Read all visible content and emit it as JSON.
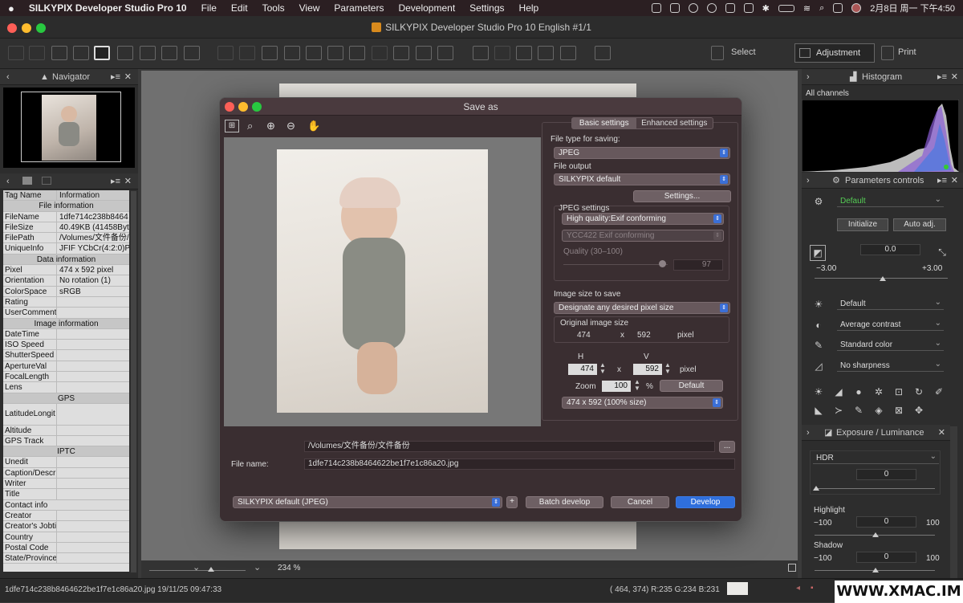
{
  "menubar": {
    "app": "SILKYPIX Developer Studio Pro 10",
    "items": [
      "File",
      "Edit",
      "Tools",
      "View",
      "Parameters",
      "Development",
      "Settings",
      "Help"
    ],
    "clock": "2月8日 周一 下午4:50"
  },
  "window": {
    "title": "SILKYPIX Developer Studio Pro 10 English   #1/1"
  },
  "toolbar": {
    "select": "Select",
    "adjustment": "Adjustment",
    "print": "Print"
  },
  "navigator": {
    "title": "Navigator"
  },
  "taginfo": {
    "col_tag": "Tag Name",
    "col_info": "Information",
    "rows": [
      {
        "type": "sec",
        "k": "File information"
      },
      {
        "k": "FileName",
        "v": "1dfe714c238b8464"
      },
      {
        "k": "FileSize",
        "v": "40.49KB (41458Byte"
      },
      {
        "k": "FilePath",
        "v": "/Volumes/文件备份/"
      },
      {
        "k": "UniqueInfo",
        "v": "JFIF YCbCr(4:2:0)Pro"
      },
      {
        "type": "sec",
        "k": "Data information"
      },
      {
        "k": "Pixel",
        "v": "474 x 592 pixel"
      },
      {
        "k": "Orientation",
        "v": "No rotation (1)"
      },
      {
        "k": "ColorSpace",
        "v": "sRGB"
      },
      {
        "k": "Rating",
        "v": ""
      },
      {
        "k": "UserComment",
        "v": ""
      },
      {
        "type": "sec",
        "k": "Image information"
      },
      {
        "k": "DateTime",
        "v": ""
      },
      {
        "k": "ISO Speed",
        "v": ""
      },
      {
        "k": "ShutterSpeed",
        "v": ""
      },
      {
        "k": "ApertureVal",
        "v": ""
      },
      {
        "k": "FocalLength",
        "v": ""
      },
      {
        "k": "Lens",
        "v": ""
      },
      {
        "type": "sec",
        "k": "GPS"
      },
      {
        "k": "LatitudeLongit",
        "v": "",
        "tall": true
      },
      {
        "k": "Altitude",
        "v": ""
      },
      {
        "k": "GPS Track",
        "v": ""
      },
      {
        "type": "sec",
        "k": "IPTC"
      },
      {
        "k": "Unedit",
        "v": ""
      },
      {
        "k": "Caption/Descr",
        "v": ""
      },
      {
        "k": "Writer",
        "v": ""
      },
      {
        "k": "Title",
        "v": ""
      },
      {
        "type": "sub",
        "k": "Contact info"
      },
      {
        "k": "Creator",
        "v": ""
      },
      {
        "k": "Creator's Jobti",
        "v": ""
      },
      {
        "k": "Country",
        "v": ""
      },
      {
        "k": "Postal Code",
        "v": ""
      },
      {
        "k": "State/Province",
        "v": ""
      }
    ]
  },
  "dialog": {
    "title": "Save as",
    "tabs": {
      "basic": "Basic settings",
      "enhanced": "Enhanced settings"
    },
    "file_type_label": "File type for saving:",
    "file_type": "JPEG",
    "file_output_label": "File output",
    "file_output": "SILKYPIX default",
    "settings_btn": "Settings...",
    "jpeg_settings_label": "JPEG settings",
    "jpeg_quality_mode": "High quality:Exif conforming",
    "ycc_mode": "YCC422 Exif conforming",
    "quality_label": "Quality (30–100)",
    "quality_value": "97",
    "image_size_label": "Image size to save",
    "image_size_mode": "Designate any desired pixel size",
    "original_size_label": "Original image size",
    "orig_w": "474",
    "x": "x",
    "orig_h": "592",
    "pixel": "pixel",
    "h_label": "H",
    "v_label": "V",
    "h_value": "474",
    "v_value": "592",
    "zoom_label": "Zoom",
    "zoom_value": "100",
    "percent": "%",
    "default_btn": "Default",
    "size_preset": "474 x   592  (100% size)",
    "path": "/Volumes/文件备份/文件备份",
    "browse_btn": "...",
    "file_name_label": "File name:",
    "file_name": "1dfe714c238b8464622be1f7e1c86a20.jpg",
    "preset": "SILKYPIX default (JPEG)",
    "add_btn": "+",
    "batch_btn": "Batch develop",
    "cancel_btn": "Cancel",
    "develop_btn": "Develop"
  },
  "histogram": {
    "title": "Histogram",
    "channel": "All channels"
  },
  "params": {
    "title": "Parameters controls",
    "taste": "Default",
    "initialize": "Initialize",
    "auto_adj": "Auto adj.",
    "exposure_value": "0.0",
    "exp_min": "−3.00",
    "exp_max": "+3.00",
    "wb": "Default",
    "contrast": "Average contrast",
    "color": "Standard color",
    "sharpness": "No sharpness"
  },
  "exposure": {
    "title": "Exposure / Luminance",
    "hdr_label": "HDR",
    "hdr_value": "0",
    "highlight_label": "Highlight",
    "highlight_min": "−100",
    "highlight_max": "100",
    "highlight_value": "0",
    "shadow_label": "Shadow",
    "shadow_min": "−100",
    "shadow_max": "100",
    "shadow_value": "0"
  },
  "canvas": {
    "zoom": "234 %"
  },
  "status": {
    "file": "1dfe714c238b8464622be1f7e1c86a20.jpg 19/11/25 09:47:33",
    "pixel_info": "( 464, 374) R:235 G:234 B:231",
    "watermark": "WWW.XMAC.IM"
  },
  "colors": {
    "accent": "#2f6fdc",
    "menubar": "#2b1f22",
    "dialog_bg": "#3a2e31"
  }
}
